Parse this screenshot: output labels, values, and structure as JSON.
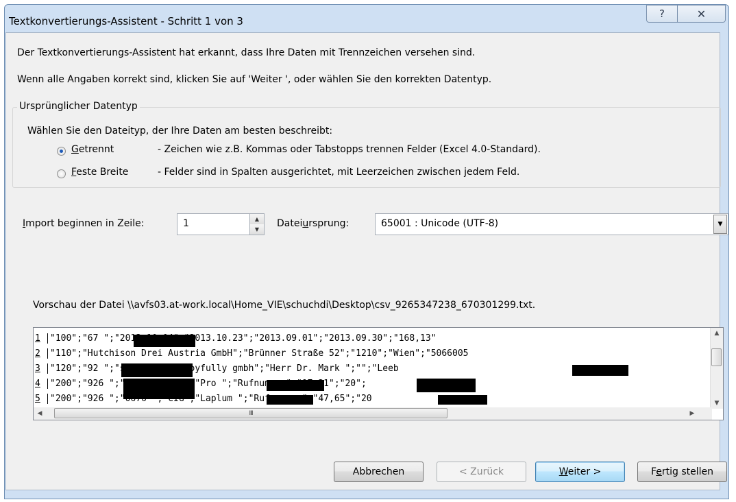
{
  "window": {
    "title": "Textkonvertierungs-Assistent - Schritt 1 von 3",
    "help_symbol": "?",
    "close_symbol": "✕"
  },
  "intro": {
    "line1": "Der Textkonvertierungs-Assistent hat erkannt, dass Ihre Daten mit Trennzeichen versehen sind.",
    "line2": "Wenn alle Angaben korrekt sind, klicken Sie auf 'Weiter ', oder wählen Sie den korrekten Datentyp."
  },
  "datatype_group": {
    "title": "Ursprünglicher Datentyp",
    "prompt": "Wählen Sie den Dateityp, der Ihre Daten am besten beschreibt:",
    "options": [
      {
        "label_first": "G",
        "label_rest": "etrennt",
        "description": "- Zeichen wie z.B. Kommas oder Tabstopps trennen Felder (Excel 4.0-Standard).",
        "selected": true
      },
      {
        "label_first": "F",
        "label_rest": "este Breite",
        "description": "- Felder sind in Spalten ausgerichtet, mit Leerzeichen zwischen jedem Feld.",
        "selected": false
      }
    ]
  },
  "start_row": {
    "label_first": "I",
    "label_rest": "mport beginnen in Zeile:",
    "value": "1"
  },
  "origin": {
    "label_pre": "Datei",
    "label_u": "u",
    "label_post": "rsprung:",
    "value": "65001 : Unicode (UTF-8)"
  },
  "preview": {
    "caption": "Vorschau der Datei \\\\avfs03.at-work.local\\Home_VIE\\schuchdi\\Desktop\\csv_9265347238_670301299.txt.",
    "rows": [
      {
        "num": "1",
        "text": "\"100\";\"67          \";\"2013.10.04\";\"2013.10.23\";\"2013.09.01\";\"2013.09.30\";\"168,13\""
      },
      {
        "num": "2",
        "text": "\"110\";\"Hutchison Drei Austria GmbH\";\"Brünner Straße 52\";\"1210\";\"Wien\";\"5066005"
      },
      {
        "num": "3",
        "text": "\"120\";\"92          \";\"serving you joyfully gmbh\";\"Herr Dr. Mark        \";\"\";\"Leeb"
      },
      {
        "num": "4",
        "text": "\"200\";\"926         \";\"0676         \";\"CIG\";\"Pro          \";\"Rufnummer\";\"17,21\";\"20\";"
      },
      {
        "num": "5",
        "text": "\"200\";\"926         \";\"0676         \";\"CIG\";\"Laplum        \";\"Rufnummer\";\"47,65\";\"20"
      }
    ],
    "hscroll_grip": "III"
  },
  "buttons": {
    "cancel": "Abbrechen",
    "back": "< Zurück",
    "next_first": "W",
    "next_rest": "eiter >",
    "finish_pre": "F",
    "finish_u": "e",
    "finish_post": "rtig stellen"
  }
}
